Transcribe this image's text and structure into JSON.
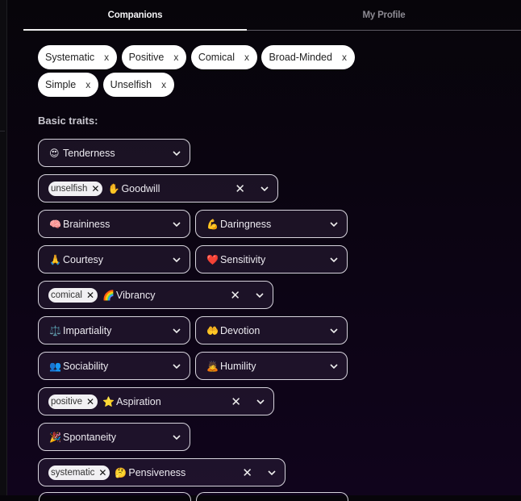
{
  "tabs": [
    {
      "label": "Companions",
      "active": true
    },
    {
      "label": "My Profile",
      "active": false
    }
  ],
  "selected_chips": [
    {
      "label": "Systematic",
      "remove": "x"
    },
    {
      "label": "Positive",
      "remove": "x"
    },
    {
      "label": "Comical",
      "remove": "x"
    },
    {
      "label": "Broad-Minded",
      "remove": "x"
    },
    {
      "label": "Simple",
      "remove": "x"
    },
    {
      "label": "Unselfish",
      "remove": "x"
    }
  ],
  "section_label": "Basic traits:",
  "traits": [
    {
      "emoji": "😍",
      "label": "Tenderness"
    },
    {
      "emoji": "✋",
      "label": "Goodwill",
      "tag": "unselfish"
    },
    {
      "emoji": "🧠",
      "label": "Braininess"
    },
    {
      "emoji": "💪",
      "label": "Daringness"
    },
    {
      "emoji": "🙏",
      "label": "Courtesy"
    },
    {
      "emoji": "❤️",
      "label": "Sensitivity"
    },
    {
      "emoji": "🌈",
      "label": "Vibrancy",
      "tag": "comical"
    },
    {
      "emoji": "⚖️",
      "label": "Impartiality"
    },
    {
      "emoji": "🤲",
      "label": "Devotion"
    },
    {
      "emoji": "👥",
      "label": "Sociability"
    },
    {
      "emoji": "🙇",
      "label": "Humility"
    },
    {
      "emoji": "⭐",
      "label": "Aspiration",
      "tag": "positive"
    },
    {
      "emoji": "🎉",
      "label": "Spontaneity"
    },
    {
      "emoji": "🤔",
      "label": "Pensiveness",
      "tag": "systematic"
    }
  ],
  "icons": {
    "clear": "✕",
    "tag_remove": "✕"
  },
  "colors": {
    "background": "#0b0412",
    "chip_bg": "#ffffff",
    "select_border": "#d6d3dc",
    "tab_underline": "#f0f0f0"
  }
}
